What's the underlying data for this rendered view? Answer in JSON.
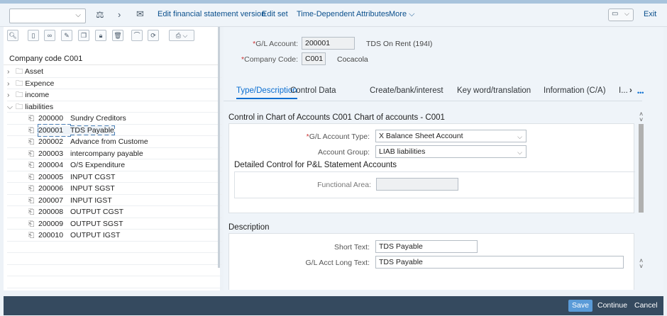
{
  "toolbar": {
    "combo_value": "",
    "items": [
      "Edit financial statement version",
      "Edit set",
      "Time-Dependent Attributes",
      "More"
    ],
    "exit": "Exit"
  },
  "tree": {
    "header": "Company code C001",
    "folders": [
      "Asset",
      "Expence",
      "income",
      "liabilities"
    ],
    "accounts": [
      [
        "200000",
        "Sundry Creditors"
      ],
      [
        "200001",
        "TDS Payable"
      ],
      [
        "200002",
        "Advance from Custome"
      ],
      [
        "200003",
        "intercompany payable"
      ],
      [
        "200004",
        "O/S Expenditure"
      ],
      [
        "200005",
        "INPUT CGST"
      ],
      [
        "200006",
        "INPUT SGST"
      ],
      [
        "200007",
        "INPUT IGST"
      ],
      [
        "200008",
        "OUTPUT CGST"
      ],
      [
        "200009",
        "OUTPUT SGST"
      ],
      [
        "200010",
        "OUTPUT IGST"
      ]
    ],
    "selected": "200001"
  },
  "header": {
    "gl_label": "G/L Account:",
    "gl_value": "200001",
    "gl_desc": "TDS On Rent (194I)",
    "cc_label": "Company Code:",
    "cc_value": "C001",
    "cc_desc": "Cocacola"
  },
  "tabs": [
    "Type/Description",
    "Control Data",
    "Create/bank/interest",
    "Key word/translation",
    "Information (C/A)",
    "I..."
  ],
  "control": {
    "title": "Control in Chart of Accounts C001 Chart of accounts - C001",
    "type_label": "G/L Account Type:",
    "type_value": "X Balance Sheet Account",
    "group_label": "Account Group:",
    "group_value": "LIAB liabilities",
    "pl_title": "Detailed Control for P&L Statement Accounts",
    "func_label": "Functional Area:",
    "func_value": ""
  },
  "description": {
    "title": "Description",
    "short_label": "Short Text:",
    "short_value": "TDS Payable",
    "long_label": "G/L Acct Long Text:",
    "long_value": "TDS Payable"
  },
  "footer": {
    "save": "Save",
    "continue": "Continue",
    "cancel": "Cancel"
  },
  "colors": {
    "accent": "#0a6ed1",
    "footer": "#354a5f"
  }
}
